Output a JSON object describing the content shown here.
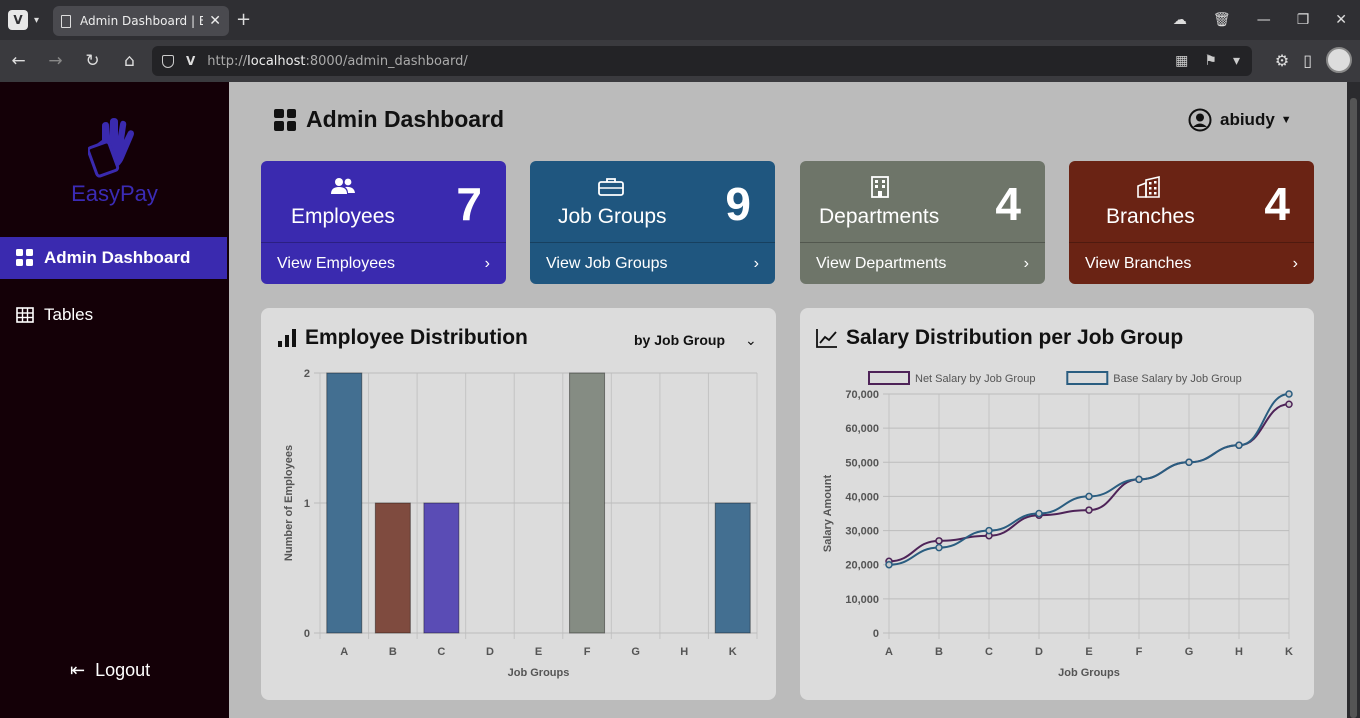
{
  "browser": {
    "tab_title": "Admin Dashboard | Eas",
    "url_prefix": "http://",
    "url_host": "localhost",
    "url_rest": ":8000/admin_dashboard/"
  },
  "sidebar": {
    "logo_text": "EasyPay",
    "items": [
      {
        "label": "Admin Dashboard",
        "icon": "grid-icon",
        "active": true
      },
      {
        "label": "Tables",
        "icon": "table-icon",
        "active": false
      }
    ],
    "logout_label": "Logout"
  },
  "header": {
    "title": "Admin Dashboard",
    "username": "abiudy"
  },
  "cards": [
    {
      "label": "Employees",
      "count": "7",
      "link": "View Employees",
      "color": "#3a2aaf",
      "icon": "users-icon"
    },
    {
      "label": "Job Groups",
      "count": "9",
      "link": "View Job Groups",
      "color": "#1f567f",
      "icon": "briefcase-icon"
    },
    {
      "label": "Departments",
      "count": "4",
      "link": "View Departments",
      "color": "#6e7569",
      "icon": "building-icon"
    },
    {
      "label": "Branches",
      "count": "4",
      "link": "View Branches",
      "color": "#6a2314",
      "icon": "city-icon"
    }
  ],
  "panels": {
    "employee_title": "Employee Distribution",
    "employee_selector": "by Job Group",
    "salary_title": "Salary Distribution per Job Group"
  },
  "chart_data": [
    {
      "type": "bar",
      "categories": [
        "A",
        "B",
        "C",
        "D",
        "E",
        "F",
        "G",
        "H",
        "K"
      ],
      "values": [
        2,
        1,
        1,
        0,
        0,
        2,
        0,
        0,
        1
      ],
      "colors": [
        "#436f91",
        "#7f4b3f",
        "#5a4cb5",
        "#888",
        "#888",
        "#858c83",
        "#888",
        "#888",
        "#436f91"
      ],
      "xlabel": "Job Groups",
      "ylabel": "Number of Employees",
      "ylim": [
        0,
        2
      ],
      "yticks": [
        0,
        1,
        2
      ]
    },
    {
      "type": "line",
      "categories": [
        "A",
        "B",
        "C",
        "D",
        "E",
        "F",
        "G",
        "H",
        "K"
      ],
      "series": [
        {
          "name": "Net Salary by Job Group",
          "values": [
            21000,
            27000,
            28500,
            34500,
            36000,
            45000,
            50000,
            55000,
            67000
          ],
          "color": "#4e2358"
        },
        {
          "name": "Base Salary by Job Group",
          "values": [
            20000,
            25000,
            30000,
            35000,
            40000,
            45000,
            50000,
            55000,
            70000
          ],
          "color": "#2a5d80"
        }
      ],
      "xlabel": "Job Groups",
      "ylabel": "Salary Amount",
      "ylim": [
        0,
        70000
      ],
      "yticks": [
        "0",
        "10,000",
        "20,000",
        "30,000",
        "40,000",
        "50,000",
        "60,000",
        "70,000"
      ],
      "legend": "top"
    }
  ]
}
